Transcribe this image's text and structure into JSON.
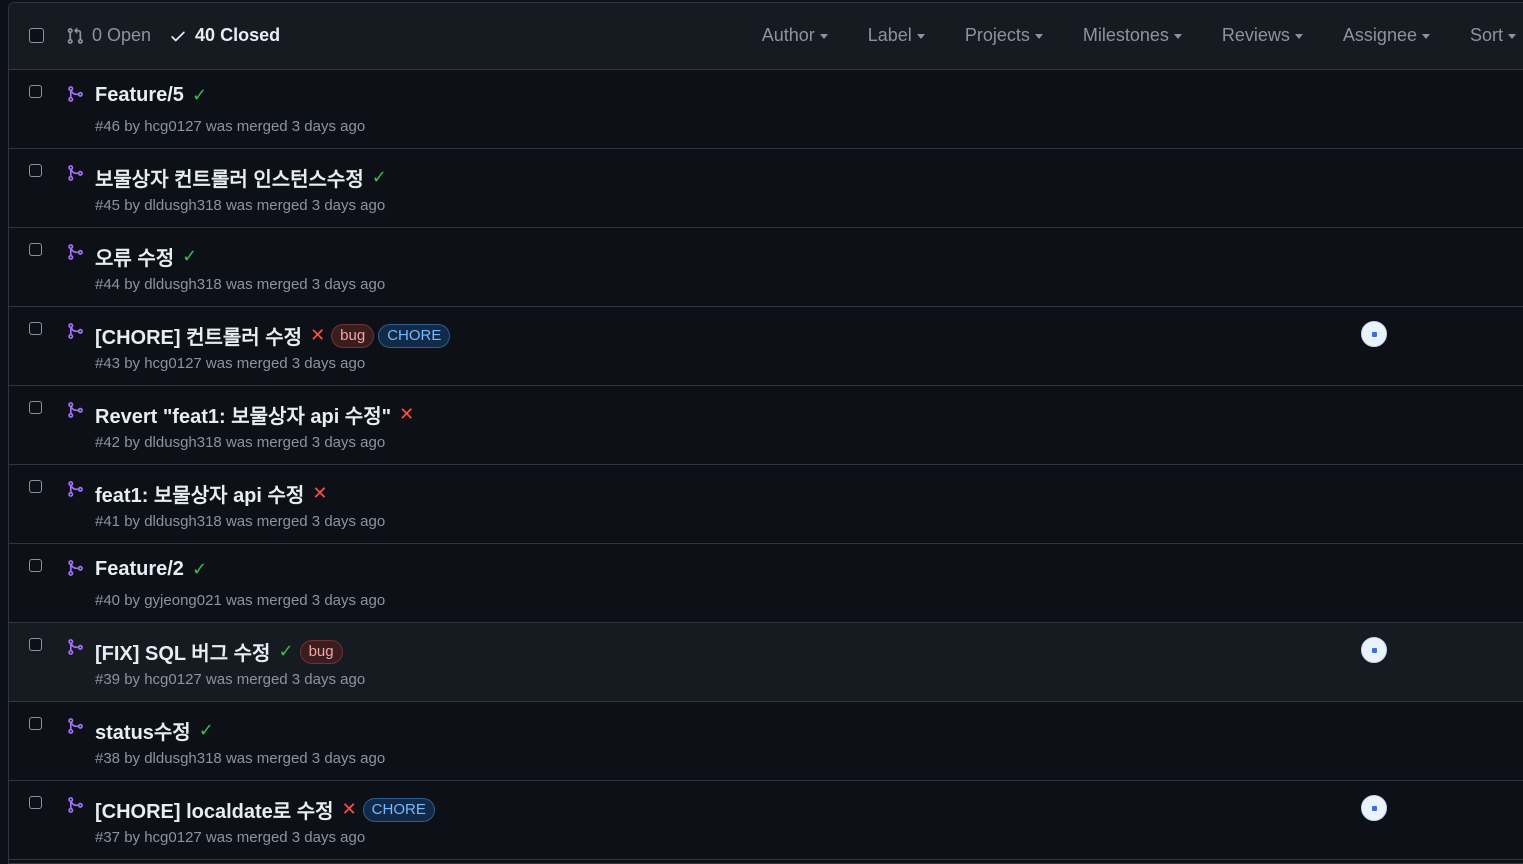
{
  "header": {
    "open_label": "0 Open",
    "closed_label": "40 Closed",
    "filters": [
      "Author",
      "Label",
      "Projects",
      "Milestones",
      "Reviews",
      "Assignee",
      "Sort"
    ]
  },
  "pulls": [
    {
      "title": "Feature/5",
      "status": "success",
      "labels": [],
      "meta": "#46 by hcg0127 was merged 3 days ago",
      "assignee": false
    },
    {
      "title": "보물상자 컨트롤러 인스턴스수정",
      "status": "success",
      "labels": [],
      "meta": "#45 by dldusgh318 was merged 3 days ago",
      "assignee": false
    },
    {
      "title": "오류 수정",
      "status": "success",
      "labels": [],
      "meta": "#44 by dldusgh318 was merged 3 days ago",
      "assignee": false
    },
    {
      "title": "[CHORE] 컨트롤러 수정",
      "status": "failure",
      "labels": [
        "bug",
        "CHORE"
      ],
      "meta": "#43 by hcg0127 was merged 3 days ago",
      "assignee": true
    },
    {
      "title": "Revert \"feat1: 보물상자 api 수정\"",
      "status": "failure",
      "labels": [],
      "meta": "#42 by dldusgh318 was merged 3 days ago",
      "assignee": false
    },
    {
      "title": "feat1: 보물상자 api 수정",
      "status": "failure",
      "labels": [],
      "meta": "#41 by dldusgh318 was merged 3 days ago",
      "assignee": false
    },
    {
      "title": "Feature/2",
      "status": "success",
      "labels": [],
      "meta": "#40 by gyjeong021 was merged 3 days ago",
      "assignee": false
    },
    {
      "title": "[FIX] SQL 버그 수정",
      "status": "success",
      "labels": [
        "bug"
      ],
      "meta": "#39 by hcg0127 was merged 3 days ago",
      "assignee": true,
      "highlight": true
    },
    {
      "title": "status수정",
      "status": "success",
      "labels": [],
      "meta": "#38 by dldusgh318 was merged 3 days ago",
      "assignee": false
    },
    {
      "title": "[CHORE] localdate로 수정",
      "status": "failure",
      "labels": [
        "CHORE"
      ],
      "meta": "#37 by hcg0127 was merged 3 days ago",
      "assignee": true
    }
  ],
  "colors": {
    "merged": "#a371f7",
    "success": "#3fb950",
    "failure": "#f85149"
  }
}
